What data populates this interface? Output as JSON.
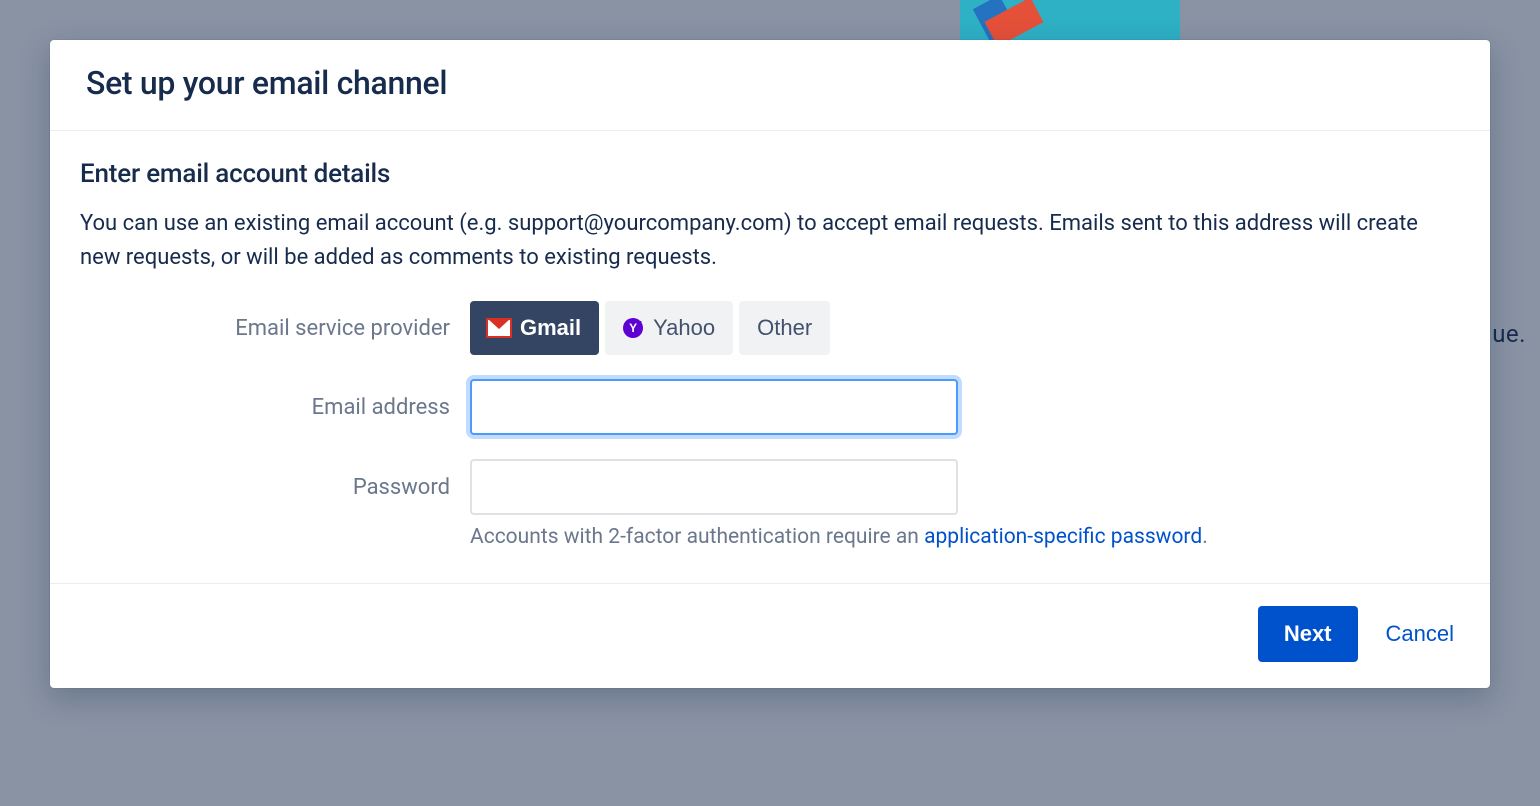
{
  "background": {
    "partial_text": "ue."
  },
  "modal": {
    "title": "Set up your email channel",
    "section_title": "Enter email account details",
    "description": "You can use an existing email account (e.g. support@yourcompany.com) to accept email requests. Emails sent to this address will create new requests, or will be added as comments to existing requests.",
    "labels": {
      "provider": "Email service provider",
      "email": "Email address",
      "password": "Password"
    },
    "providers": {
      "gmail": "Gmail",
      "yahoo": "Yahoo",
      "other": "Other",
      "selected": "gmail"
    },
    "fields": {
      "email_value": "",
      "password_value": ""
    },
    "hint": {
      "prefix": "Accounts with 2-factor authentication require an ",
      "link": "application-specific password",
      "suffix": "."
    },
    "footer": {
      "next": "Next",
      "cancel": "Cancel"
    }
  }
}
